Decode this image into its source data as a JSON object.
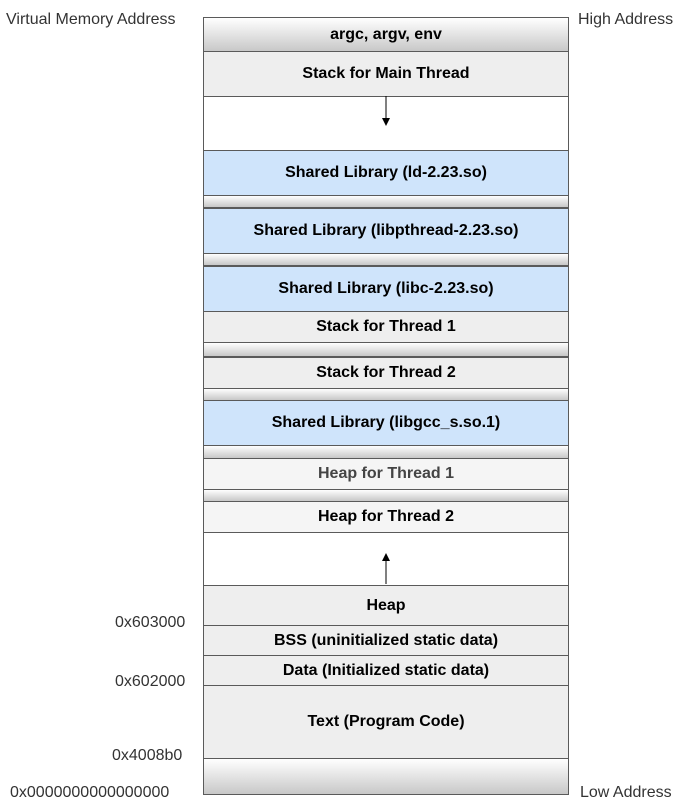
{
  "labels": {
    "title": "Virtual Memory Address",
    "high": "High Address",
    "low": "Low Address"
  },
  "addresses": [
    "0x603000",
    "0x602000",
    "0x4008b0",
    "0x0000000000000000"
  ],
  "segments": {
    "args": "argc, argv, env",
    "main_stack": "Stack for Main Thread",
    "ld": "Shared Library (ld-2.23.so)",
    "pthread": "Shared Library (libpthread-2.23.so)",
    "libc": "Shared Library (libc-2.23.so)",
    "stack_t1": "Stack for Thread 1",
    "stack_t2": "Stack for Thread 2",
    "libgcc": "Shared Library (libgcc_s.so.1)",
    "heap_t1": "Heap for Thread 1",
    "heap_t2": "Heap for Thread 2",
    "heap": "Heap",
    "bss": "BSS (uninitialized static data)",
    "data": "Data (Initialized static data)",
    "text": "Text (Program Code)"
  },
  "colors": {
    "shared_library": "#cfe4fb",
    "segment": "#eeeeee",
    "border": "#5a5a5a"
  }
}
